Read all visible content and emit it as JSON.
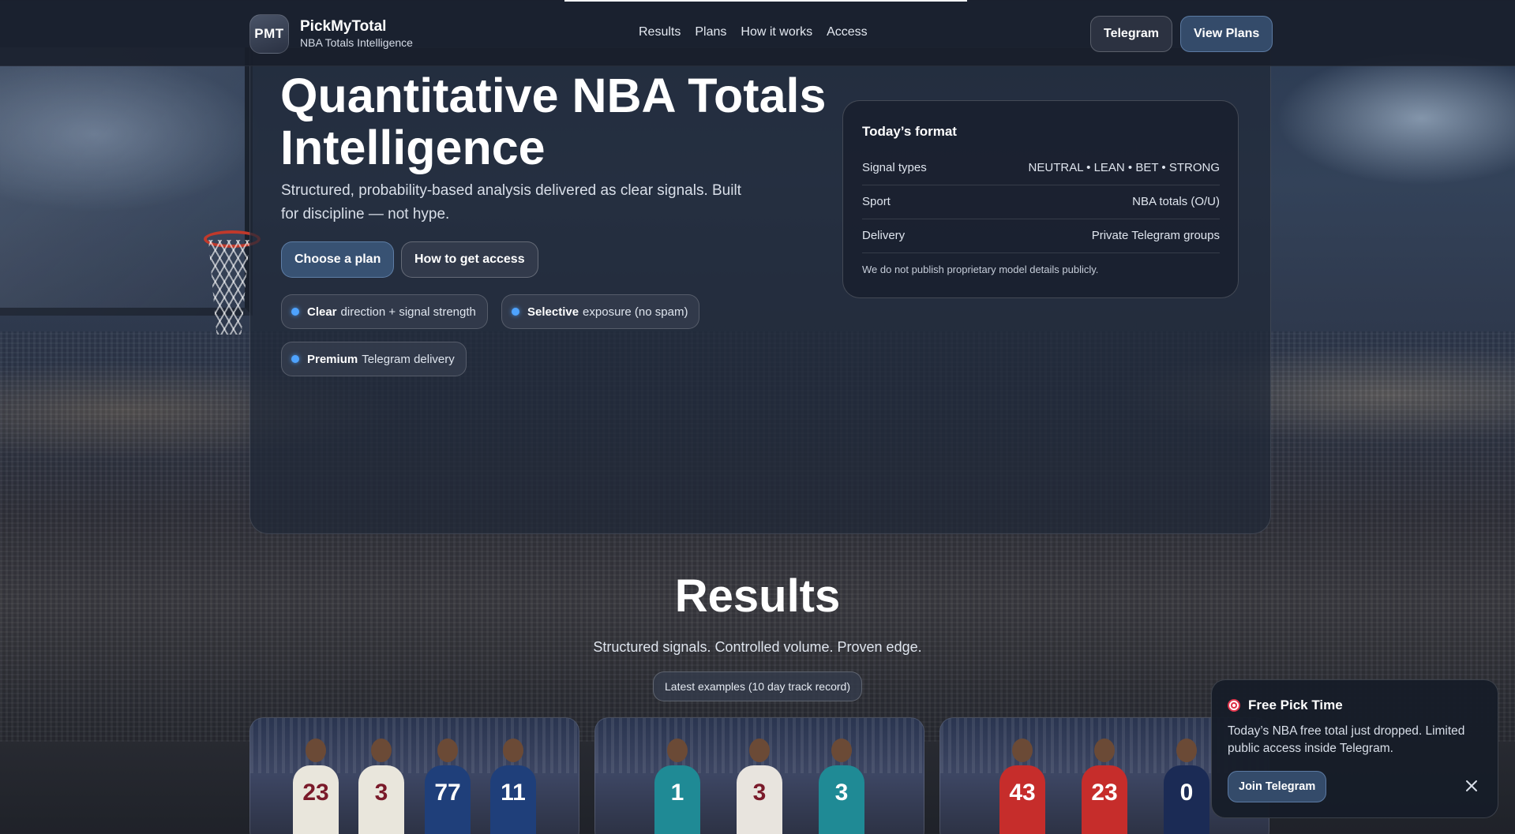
{
  "header": {
    "logo_text": "PMT",
    "brand_name": "PickMyTotal",
    "brand_sub": "NBA Totals Intelligence",
    "nav": [
      "Results",
      "Plans",
      "How it works",
      "Access"
    ],
    "telegram_button": "Telegram",
    "view_plans_button": "View Plans"
  },
  "hero": {
    "title_line1": "Quantitative NBA Totals",
    "title_line2": "Intelligence",
    "subtitle_line1": "Structured, probability-based analysis delivered as clear signals. Built",
    "subtitle_line2": "for discipline — not hype.",
    "choose_plan_button": "Choose a plan",
    "get_access_button": "How to get access",
    "chips": [
      {
        "bold": "Clear",
        "text": "direction + signal strength"
      },
      {
        "bold": "Selective",
        "text": "exposure (no spam)"
      },
      {
        "bold": "Premium",
        "text": "Telegram delivery"
      }
    ]
  },
  "format_card": {
    "title": "Today’s format",
    "rows": [
      {
        "label": "Signal types",
        "value": "NEUTRAL • LEAN • BET • STRONG"
      },
      {
        "label": "Sport",
        "value": "NBA totals (O/U)"
      },
      {
        "label": "Delivery",
        "value": "Private Telegram groups"
      }
    ],
    "note": "We do not publish proprietary model details publicly."
  },
  "results": {
    "title": "Results",
    "subtitle": "Structured signals. Controlled volume. Proven edge.",
    "badge": "Latest examples (10 day track record)",
    "thumbnails": [
      {
        "jerseys": [
          "23",
          "3",
          "77",
          "11"
        ],
        "colors": [
          "#e9e6dc",
          "#e9e6dc",
          "#1f3f7a",
          "#1f3f7a"
        ]
      },
      {
        "jerseys": [
          "1",
          "3",
          "3"
        ],
        "colors": [
          "#1f8a95",
          "#e8e4de",
          "#1f8a95"
        ]
      },
      {
        "jerseys": [
          "43",
          "23",
          "0"
        ],
        "colors": [
          "#c62d2b",
          "#c62d2b",
          "#1b2b55"
        ]
      }
    ]
  },
  "toast": {
    "title": "Free Pick Time",
    "text": "Today’s NBA free total just dropped. Limited public access inside Telegram.",
    "button": "Join Telegram"
  }
}
